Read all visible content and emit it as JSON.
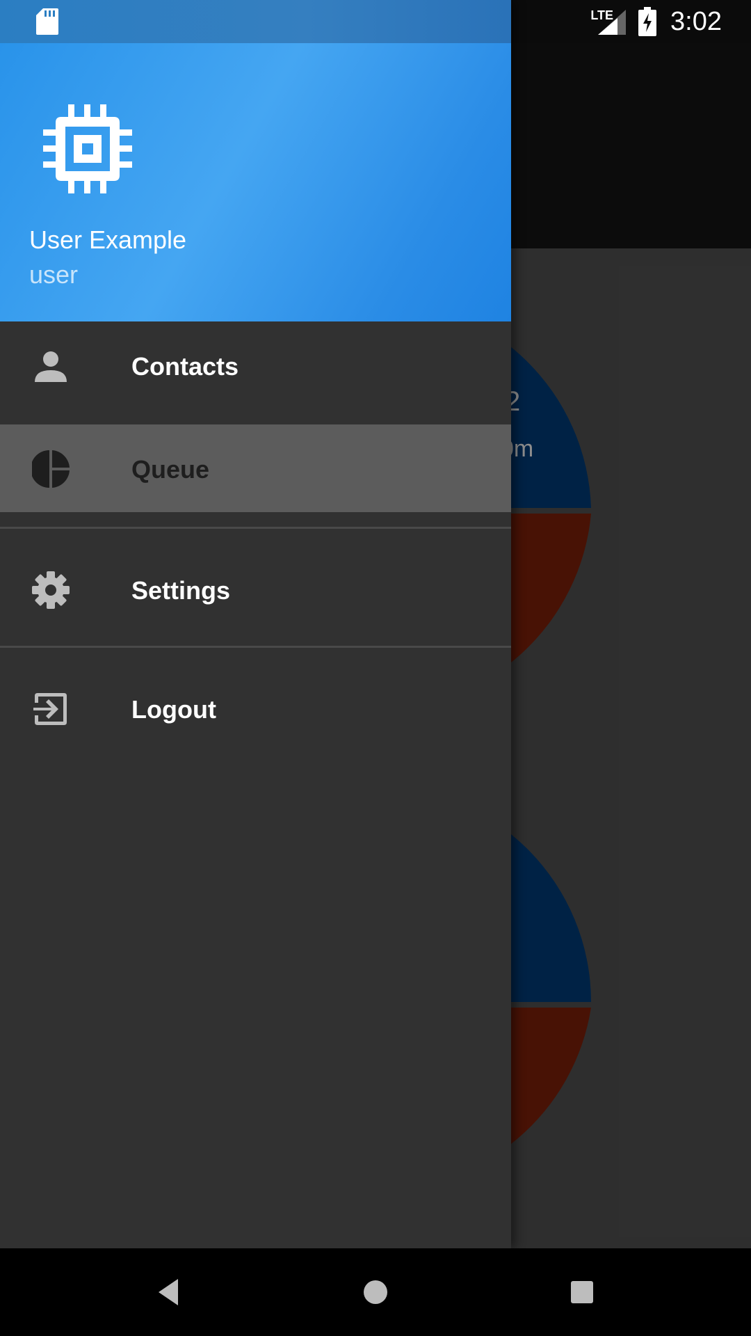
{
  "status_bar": {
    "time": "3:02",
    "network": "LTE",
    "icons": [
      "sd-card-icon",
      "signal-icon",
      "battery-charging-icon"
    ]
  },
  "background_app": {
    "pie_fragments": [
      "2",
      "0m"
    ],
    "colors": {
      "series_a": "#002a5a",
      "series_b": "#511507"
    }
  },
  "drawer": {
    "header": {
      "icon": "chip-icon",
      "user_name": "User Example",
      "user_role": "user",
      "accent": "#2993ea"
    },
    "items": [
      {
        "label": "Contacts",
        "icon": "person-icon",
        "active": false
      },
      {
        "label": "Queue",
        "icon": "pie-chart-icon",
        "active": true
      },
      {
        "label": "Settings",
        "icon": "gear-icon",
        "active": false
      },
      {
        "label": "Logout",
        "icon": "logout-icon",
        "active": false
      }
    ]
  },
  "nav_bar": {
    "buttons": [
      "back-icon",
      "home-icon",
      "recents-icon"
    ]
  }
}
